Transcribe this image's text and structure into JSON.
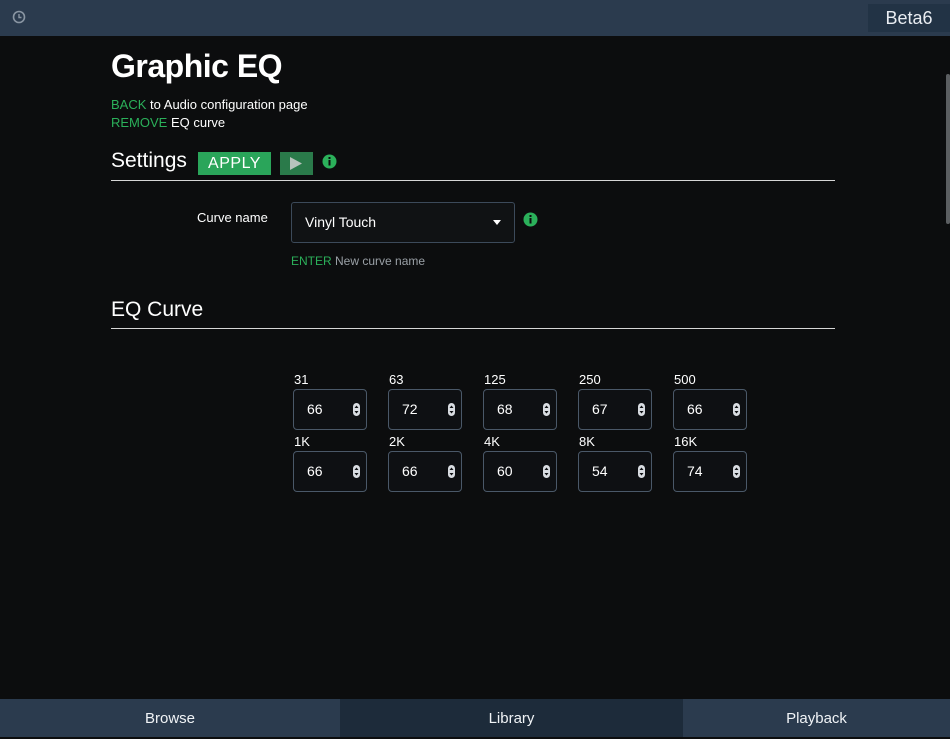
{
  "header": {
    "version": "Beta6",
    "icons": {
      "clock": "clock-icon"
    }
  },
  "page": {
    "title": "Graphic EQ",
    "back_action": "BACK",
    "back_text": "to Audio configuration page",
    "remove_action": "REMOVE",
    "remove_text": "EQ curve"
  },
  "settings": {
    "title": "Settings",
    "apply_label": "APPLY",
    "play_icon": "play-icon",
    "info_icon": "info-icon",
    "curve_label": "Curve name",
    "curve_value": "Vinyl Touch",
    "enter_action": "ENTER",
    "enter_text": "New curve name"
  },
  "eq": {
    "title": "EQ Curve",
    "bands": [
      {
        "freq": "31",
        "value": "66"
      },
      {
        "freq": "63",
        "value": "72"
      },
      {
        "freq": "125",
        "value": "68"
      },
      {
        "freq": "250",
        "value": "67"
      },
      {
        "freq": "500",
        "value": "66"
      },
      {
        "freq": "1K",
        "value": "66"
      },
      {
        "freq": "2K",
        "value": "66"
      },
      {
        "freq": "4K",
        "value": "60"
      },
      {
        "freq": "8K",
        "value": "54"
      },
      {
        "freq": "16K",
        "value": "74"
      }
    ]
  },
  "nav": {
    "browse": "Browse",
    "library": "Library",
    "playback": "Playback"
  },
  "colors": {
    "accent_green": "#2bb05a",
    "bar_blue": "#2b3b4e",
    "background": "#0c0d0e"
  }
}
